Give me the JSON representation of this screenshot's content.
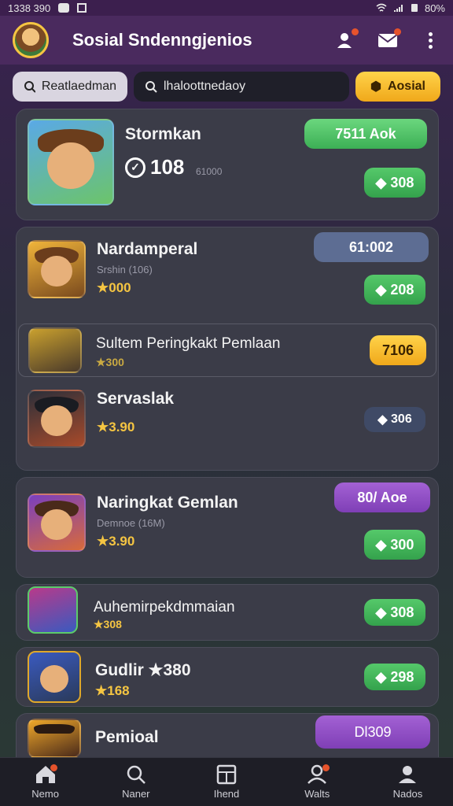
{
  "status_bar": {
    "time": "1338 390",
    "battery": "80%"
  },
  "app_bar": {
    "title": "Sosial Sndenngjenios"
  },
  "filters": {
    "chip1": "Reatlaedman",
    "search_placeholder": "lhaloottnedaoy",
    "chip3": "Aosial"
  },
  "featured": {
    "name": "Stormkan",
    "score": "108",
    "score_sub": "61000",
    "badge": "7511 Aok",
    "button": "308"
  },
  "items": [
    {
      "name": "Nardamperal",
      "sub": "Srshin (106)",
      "rating": "★000",
      "badge": "61:002",
      "button": "208"
    },
    {
      "name": "Sultem Peringkakt Pemlaan",
      "rating": "★300",
      "badge": "7106"
    },
    {
      "name": "Servaslak",
      "rating": "★3.90",
      "button": "306"
    },
    {
      "name": "Naringkat Gemlan",
      "sub": "Demnoe (16M)",
      "rating": "★3.90",
      "badge": "80/ Aoe",
      "button": "300"
    },
    {
      "name": "Auhemirpekdmmaian",
      "rating": "★308",
      "button": "308"
    },
    {
      "name": "Gudlir ★380",
      "rating": "★168",
      "button": "298"
    },
    {
      "name": "Pemioal",
      "badge": "Dl309"
    }
  ],
  "bottom_nav": [
    "Nemo",
    "Naner",
    "Ihend",
    "Walts",
    "Nados"
  ]
}
